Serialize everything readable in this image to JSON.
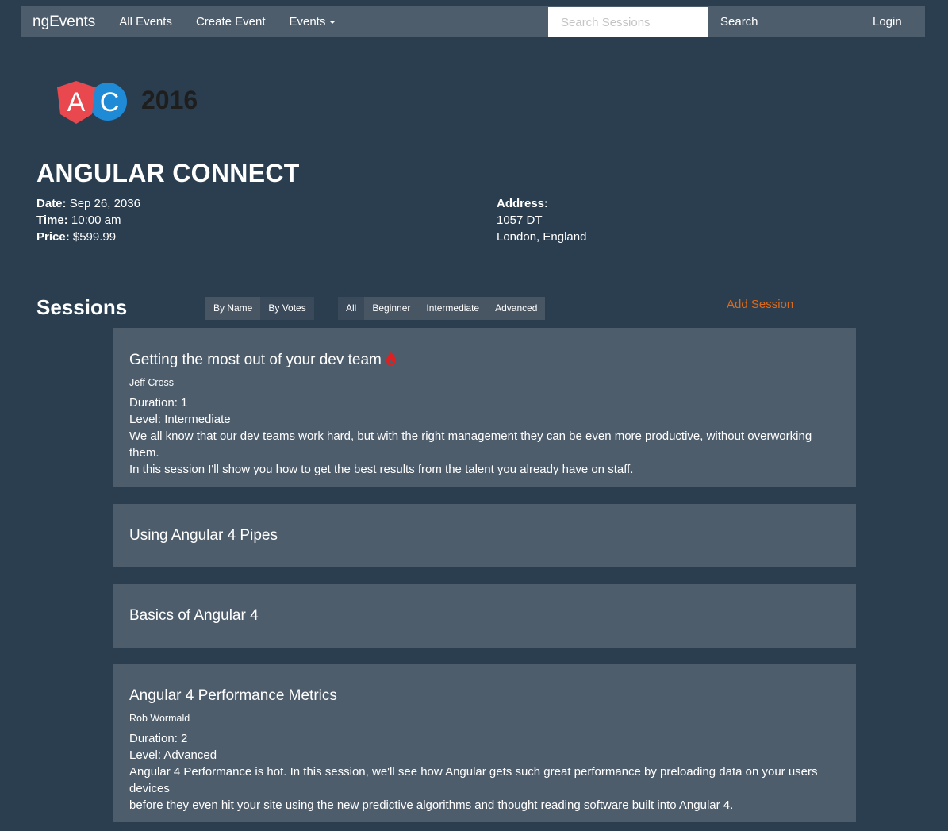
{
  "navbar": {
    "brand": "ngEvents",
    "links": [
      "All Events",
      "Create Event",
      "Events"
    ],
    "search_placeholder": "Search Sessions",
    "search_button": "Search",
    "login": "Login"
  },
  "logo": {
    "letters": [
      "A",
      "C"
    ],
    "year": "2016",
    "colors": {
      "a": "#e8484e",
      "c": "#1f8ad6"
    }
  },
  "event": {
    "name": "ANGULAR CONNECT",
    "date_label": "Date:",
    "date": "Sep 26, 2036",
    "time_label": "Time:",
    "time": "10:00 am",
    "price_label": "Price:",
    "price": "$599.99",
    "address_label": "Address:",
    "address_line1": "1057 DT",
    "address_line2": "London, England"
  },
  "sessions": {
    "heading": "Sessions",
    "sort_buttons": [
      "By Name",
      "By Votes"
    ],
    "filter_buttons": [
      "All",
      "Beginner",
      "Intermediate",
      "Advanced"
    ],
    "add_session": "Add Session",
    "items": [
      {
        "title": "Getting the most out of your dev team",
        "hot": true,
        "presenter": "Jeff Cross",
        "duration": "Duration: 1",
        "level": "Level: Intermediate",
        "abstract_line1": "We all know that our dev teams work hard, but with the right management they can be even more productive, without overworking them.",
        "abstract_line2": "In this session I'll show you how to get the best results from the talent you already have on staff."
      },
      {
        "title": "Using Angular 4 Pipes"
      },
      {
        "title": "Basics of Angular 4"
      },
      {
        "title": "Angular 4 Performance Metrics",
        "presenter": "Rob Wormald",
        "duration": "Duration: 2",
        "level": "Level: Advanced",
        "abstract_line1": "Angular 4 Performance is hot. In this session, we'll see how Angular gets such great performance by preloading data on your users devices",
        "abstract_line2": "before they even hit your site using the new predictive algorithms and thought reading software built into Angular 4."
      }
    ]
  },
  "colors": {
    "background": "#2b3e50",
    "panel": "#4e5d6c",
    "accent": "#df691a",
    "hot": "#e02020"
  }
}
